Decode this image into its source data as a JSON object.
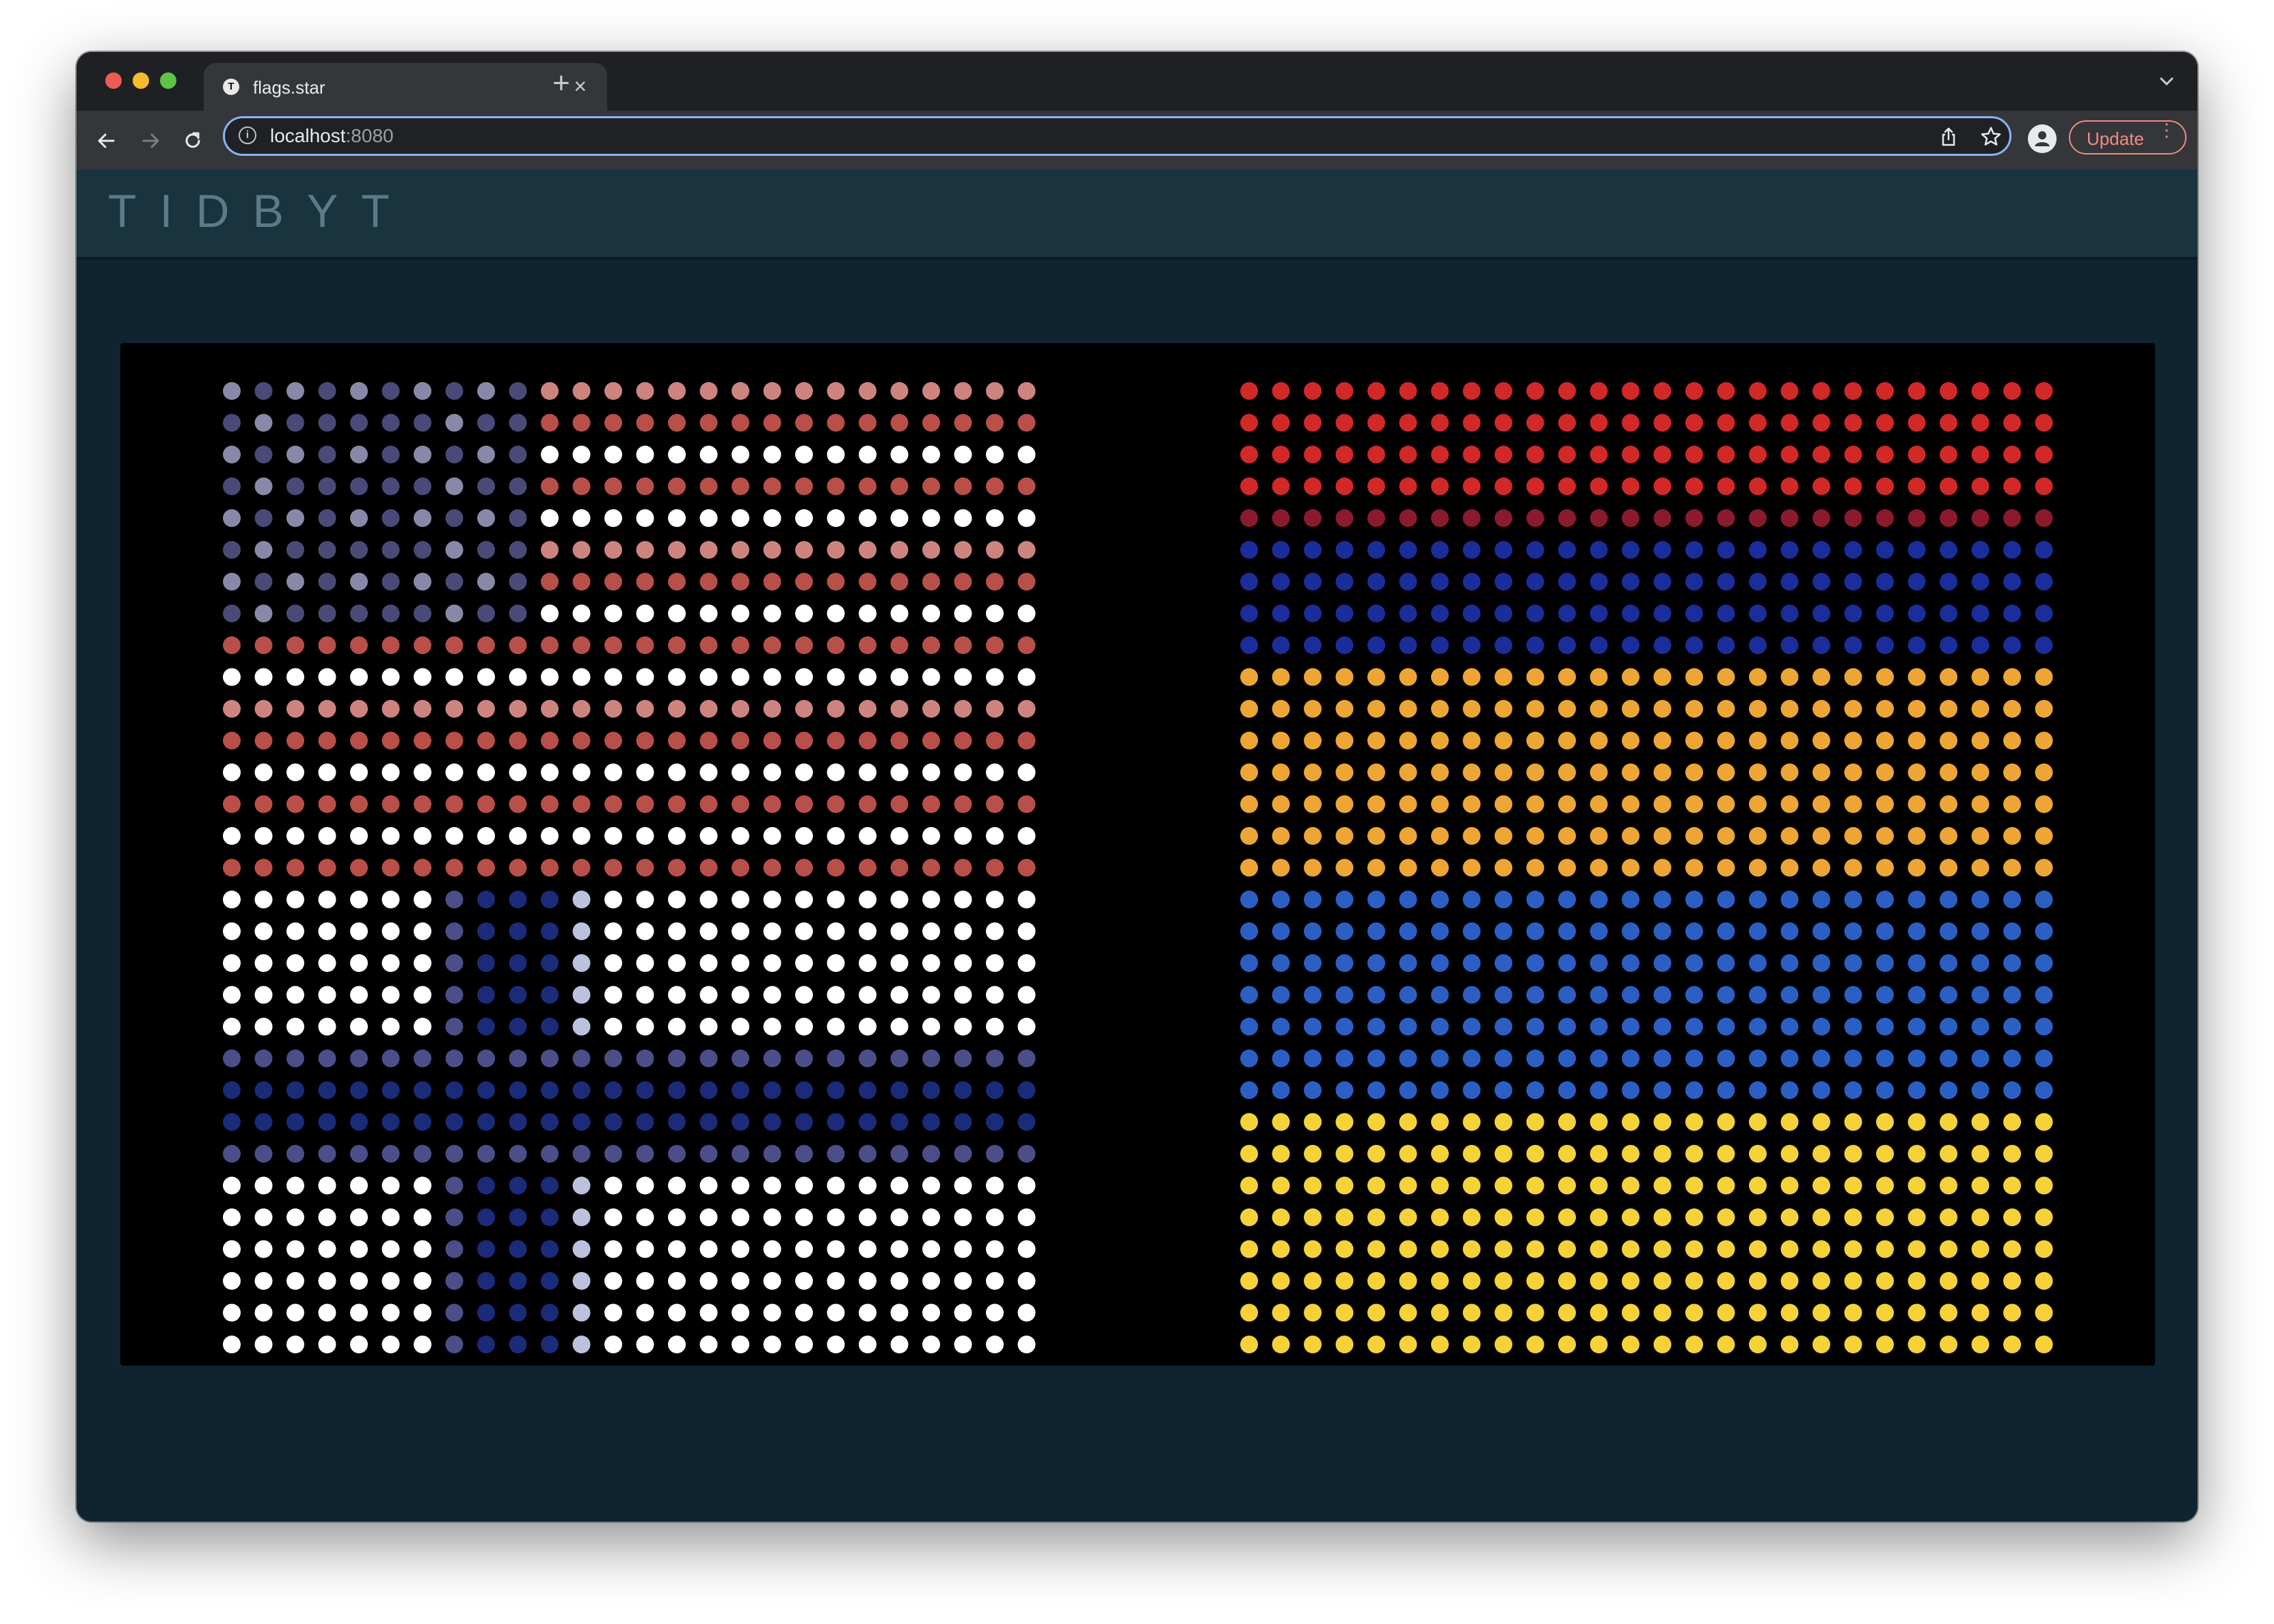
{
  "browser": {
    "tab": {
      "favicon_letter": "T",
      "title": "flags.star",
      "close_glyph": "×"
    },
    "new_tab_glyph": "+",
    "omnibox": {
      "host": "localhost",
      "port": ":8080",
      "info_icon_glyph": "i"
    },
    "update_label": "Update",
    "menu_glyph": "⋮"
  },
  "page": {
    "logo": "TIDBYT"
  },
  "display": {
    "grid_cols": 64,
    "grid_rows": 32,
    "flags": [
      {
        "name": "United States",
        "colors": {
          "red": "#b84f48",
          "white": "#ffffff",
          "blue": "#4a4a78"
        }
      },
      {
        "name": "Armenia",
        "colors": {
          "red": "#d12828",
          "dark_red": "#8a1a2c",
          "blue": "#1b2d9a",
          "orange": "#eda635"
        }
      },
      {
        "name": "Finland",
        "colors": {
          "white": "#ffffff",
          "blue": "#1b2b7a",
          "mid_blue": "#4c4e8a",
          "light_blue": "#bcc2dc"
        }
      },
      {
        "name": "Ukraine",
        "colors": {
          "blue": "#2c5fc4",
          "yellow": "#f5d23a"
        }
      }
    ]
  }
}
